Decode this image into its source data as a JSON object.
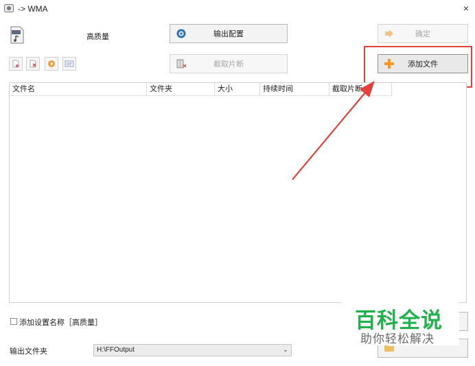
{
  "window": {
    "title": "-> WMA",
    "close_glyph": "×"
  },
  "profile": {
    "label": "高质量",
    "icon": "wma-file-icon"
  },
  "toolbar": {
    "output_config_label": "输出配置",
    "confirm_label": "确定",
    "clip_label": "截取片断",
    "add_file_label": "添加文件"
  },
  "table": {
    "columns": [
      "文件名",
      "文件夹",
      "大小",
      "持续时间",
      "截取片断"
    ],
    "rows": []
  },
  "options": {
    "add_settings_name_label": "添加设置名称［高质量］",
    "add_settings_name_checked": false
  },
  "output": {
    "folder_label": "输出文件夹",
    "folder_value": "H:\\FFOutput"
  },
  "watermark": {
    "title": "百科全说",
    "subtitle": "助你轻松解决"
  },
  "colors": {
    "highlight": "#e0413a",
    "watermark": "#22b14c",
    "add_icon": "#f39a1e"
  }
}
